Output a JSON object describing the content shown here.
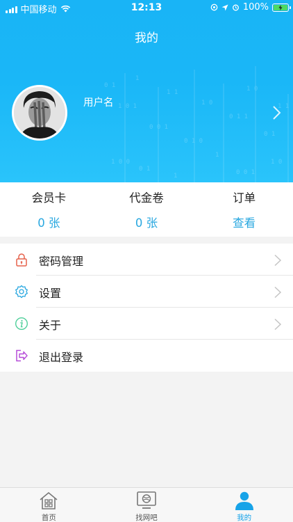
{
  "status_bar": {
    "carrier": "中国移动",
    "time": "12:13",
    "battery": "100%"
  },
  "header": {
    "title": "我的"
  },
  "profile": {
    "username": "用户名"
  },
  "stats": [
    {
      "label": "会员卡",
      "value": "0 张"
    },
    {
      "label": "代金卷",
      "value": "0 张"
    },
    {
      "label": "订单",
      "value": "查看"
    }
  ],
  "menu": [
    {
      "label": "密码管理",
      "icon": "lock-icon"
    },
    {
      "label": "设置",
      "icon": "gear-icon"
    },
    {
      "label": "关于",
      "icon": "info-icon"
    },
    {
      "label": "退出登录",
      "icon": "logout-icon"
    }
  ],
  "tabbar": [
    {
      "label": "首页",
      "icon": "home-icon"
    },
    {
      "label": "找网吧",
      "icon": "monitor-globe-icon"
    },
    {
      "label": "我的",
      "icon": "person-icon"
    }
  ],
  "colors": {
    "header_bg": "#1ab7f7",
    "accent": "#2aa8e0",
    "tab_active": "#17a3e8"
  }
}
